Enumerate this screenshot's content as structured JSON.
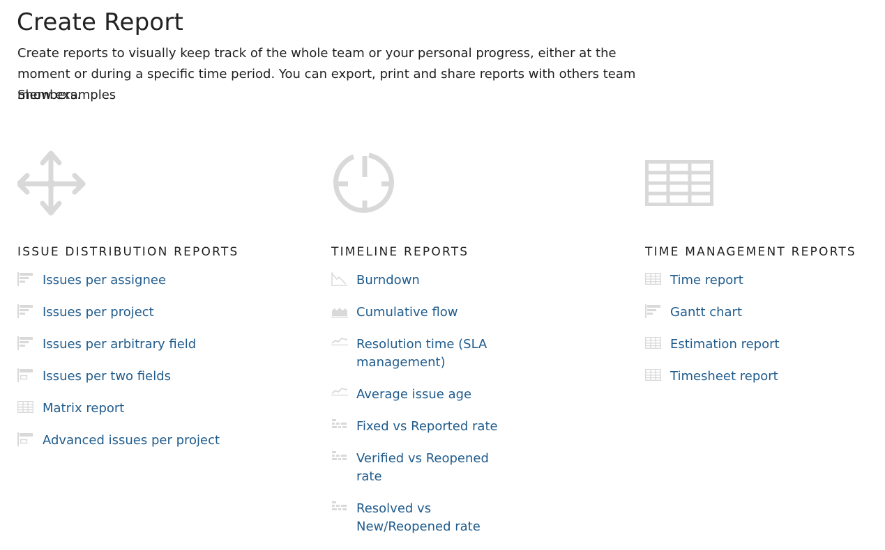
{
  "page": {
    "title": "Create Report",
    "description": "Create reports to visually keep track of the whole team or your personal progress, either at the moment or during a specific time period. You can export, print and share reports with others team members.",
    "show_examples": "Show examples"
  },
  "colors": {
    "link": "#1f5b8c",
    "icon": "#d9d9d9",
    "text": "#1f1f1f"
  },
  "columns": [
    {
      "big_icon": "move-arrows-icon",
      "heading": "ISSUE DISTRIBUTION REPORTS",
      "items": [
        {
          "label": "Issues per assignee",
          "icon": "bar-list-icon"
        },
        {
          "label": "Issues per project",
          "icon": "bar-list-icon"
        },
        {
          "label": "Issues per arbitrary field",
          "icon": "bar-list-icon"
        },
        {
          "label": "Issues per two fields",
          "icon": "two-fields-icon"
        },
        {
          "label": "Matrix report",
          "icon": "table-icon"
        },
        {
          "label": "Advanced issues per project",
          "icon": "two-fields-icon"
        }
      ]
    },
    {
      "big_icon": "timer-icon",
      "heading": "TIMELINE REPORTS",
      "items": [
        {
          "label": "Burndown",
          "icon": "burndown-icon"
        },
        {
          "label": "Cumulative flow",
          "icon": "area-chart-icon"
        },
        {
          "label": "Resolution time (SLA management)",
          "icon": "line-chart-icon"
        },
        {
          "label": "Average issue age",
          "icon": "line-chart-icon"
        },
        {
          "label": "Fixed vs Reported rate",
          "icon": "rate-icon"
        },
        {
          "label": "Verified vs Reopened rate",
          "icon": "rate-icon"
        },
        {
          "label": "Resolved vs New/Reopened rate",
          "icon": "rate-icon"
        }
      ]
    },
    {
      "big_icon": "grid-table-icon",
      "heading": "TIME MANAGEMENT REPORTS",
      "items": [
        {
          "label": "Time report",
          "icon": "table-icon"
        },
        {
          "label": "Gantt chart",
          "icon": "bar-list-icon"
        },
        {
          "label": "Estimation report",
          "icon": "table-icon"
        },
        {
          "label": "Timesheet report",
          "icon": "table-icon"
        }
      ]
    }
  ]
}
